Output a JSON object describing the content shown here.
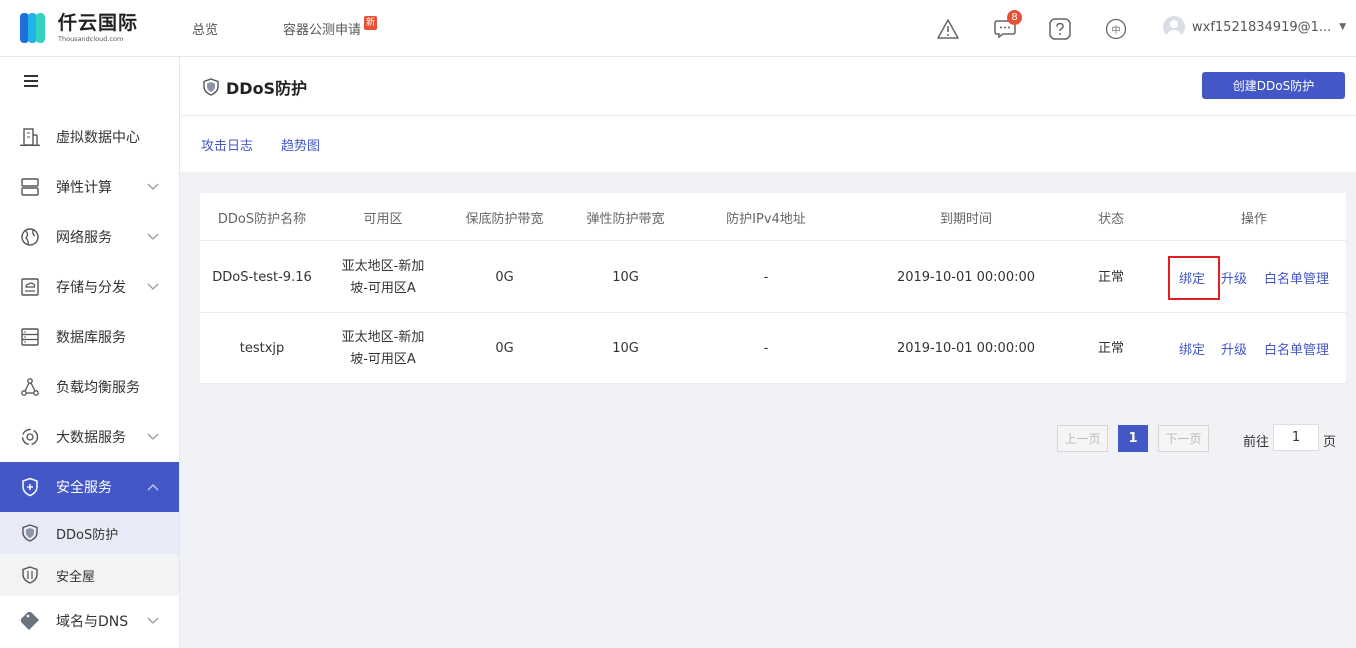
{
  "header": {
    "logo_cn": "仟云国际",
    "logo_en": "Thousandcloud.com",
    "nav": [
      {
        "label": "总览"
      },
      {
        "label": "容器公测申请",
        "badge": "新"
      }
    ],
    "notification_count": "8",
    "lang_label": "中",
    "user_name": "wxf1521834919@1..."
  },
  "sidebar": {
    "items": [
      {
        "label": "虚拟数据中心",
        "icon": "datacenter-icon"
      },
      {
        "label": "弹性计算",
        "icon": "server-icon"
      },
      {
        "label": "网络服务",
        "icon": "globe-icon"
      },
      {
        "label": "存储与分发",
        "icon": "storage-icon"
      },
      {
        "label": "数据库服务",
        "icon": "database-icon"
      },
      {
        "label": "负载均衡服务",
        "icon": "loadbalancer-icon"
      },
      {
        "label": "大数据服务",
        "icon": "bigdata-icon"
      },
      {
        "label": "安全服务",
        "icon": "shield-icon"
      },
      {
        "label": "域名与DNS",
        "icon": "tag-icon"
      }
    ],
    "security_sub": [
      {
        "label": "DDoS防护"
      },
      {
        "label": "安全屋"
      }
    ]
  },
  "page": {
    "title": "DDoS防护",
    "create_button": "创建DDoS防护",
    "tabs": [
      "攻击日志",
      "趋势图"
    ]
  },
  "table": {
    "columns": [
      "DDoS防护名称",
      "可用区",
      "保底防护带宽",
      "弹性防护带宽",
      "防护IPv4地址",
      "到期时间",
      "状态",
      "操作"
    ],
    "rows": [
      {
        "name": "DDoS-test-9.16",
        "zone": "亚太地区-新加坡-可用区A",
        "base_bw": "0G",
        "elastic_bw": "10G",
        "ipv4": "-",
        "expire": "2019-10-01 00:00:00",
        "status": "正常",
        "ops": [
          "绑定",
          "升级",
          "白名单管理"
        ]
      },
      {
        "name": "testxjp",
        "zone": "亚太地区-新加坡-可用区A",
        "base_bw": "0G",
        "elastic_bw": "10G",
        "ipv4": "-",
        "expire": "2019-10-01 00:00:00",
        "status": "正常",
        "ops": [
          "绑定",
          "升级",
          "白名单管理"
        ]
      }
    ]
  },
  "pagination": {
    "prev": "上一页",
    "current": "1",
    "next": "下一页",
    "goto_prefix": "前往",
    "goto_value": "1",
    "goto_suffix": "页"
  },
  "colors": {
    "accent": "#4358c6",
    "badge": "#e94f34",
    "highlight": "#e02020"
  }
}
